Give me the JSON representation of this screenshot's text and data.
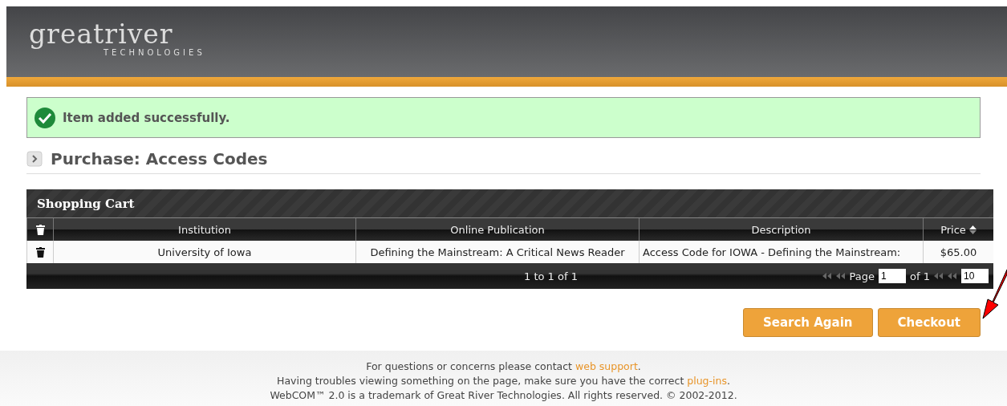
{
  "header": {
    "logo": "greatriver",
    "logo_sub": "TECHNOLOGIES"
  },
  "alert": {
    "kind": "success",
    "message": "Item added successfully."
  },
  "page_title": "Purchase: Access Codes",
  "cart": {
    "title": "Shopping Cart",
    "columns": [
      {
        "label": "Institution",
        "sortable": false
      },
      {
        "label": "Online Publication",
        "sortable": false
      },
      {
        "label": "Description",
        "sortable": false
      },
      {
        "label": "Price",
        "sortable": true
      }
    ],
    "rows": [
      {
        "cells": [
          "University of Iowa",
          "Defining the Mainstream: A Critical News Reader",
          "Access Code for IOWA - Defining the Mainstream:",
          "$65.00"
        ]
      }
    ],
    "summary": "1 to 1 of 1",
    "pager": {
      "page_label": "Page",
      "page": "1",
      "of": "of 1",
      "page_size": "10"
    }
  },
  "buttons": [
    "Search Again",
    "Checkout"
  ],
  "footer": [
    {
      "text": "For questions or concerns please contact ",
      "link": "web support",
      "after": "."
    },
    {
      "text": "Having troubles viewing something on the page, make sure you have the correct ",
      "link": "plug-ins",
      "after": "."
    },
    {
      "text": "WebCOM™ 2.0 is a trademark of Great River Technologies. All rights reserved. © 2002-2012."
    }
  ]
}
